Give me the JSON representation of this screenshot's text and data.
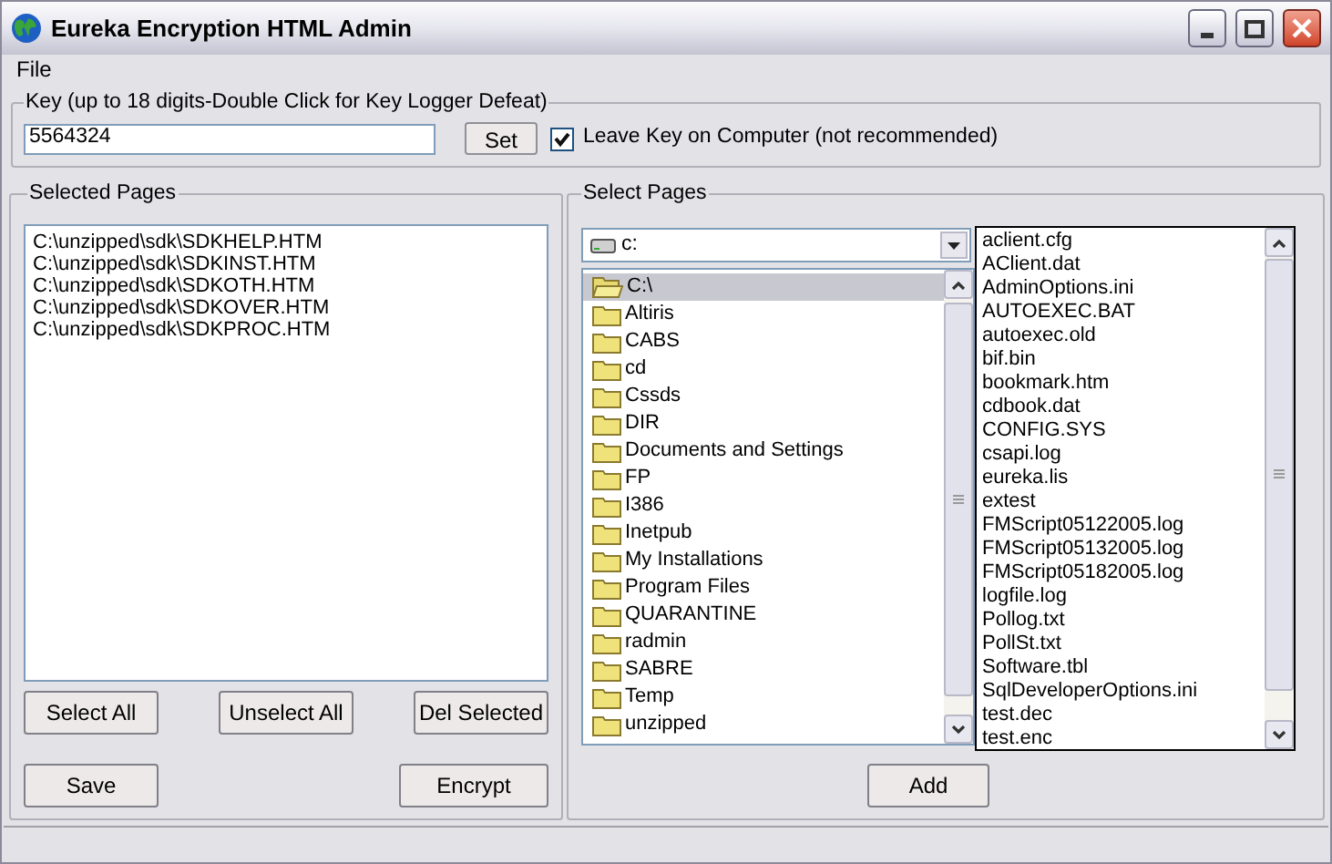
{
  "window": {
    "title": "Eureka Encryption HTML Admin"
  },
  "menu": [
    "File"
  ],
  "key_group": {
    "legend": "Key (up to 18 digits-Double Click for Key Logger Defeat)",
    "value": "5564324",
    "set_button": "Set",
    "leave_key": {
      "label": "Leave Key on Computer (not recommended)",
      "checked": true
    }
  },
  "selected_pages": {
    "legend": "Selected Pages",
    "items": [
      "C:\\unzipped\\sdk\\SDKHELP.HTM",
      "C:\\unzipped\\sdk\\SDKINST.HTM",
      "C:\\unzipped\\sdk\\SDKOTH.HTM",
      "C:\\unzipped\\sdk\\SDKOVER.HTM",
      "C:\\unzipped\\sdk\\SDKPROC.HTM"
    ],
    "buttons": [
      "Select All",
      "Unselect All",
      "Del Selected"
    ],
    "bottom_buttons": [
      "Save",
      "Encrypt"
    ]
  },
  "select_pages": {
    "legend": "Select Pages",
    "drive": "c:",
    "folders": [
      {
        "label": "C:\\",
        "selected": true
      },
      {
        "label": "Altiris",
        "selected": false
      },
      {
        "label": "CABS",
        "selected": false
      },
      {
        "label": "cd",
        "selected": false
      },
      {
        "label": "Cssds",
        "selected": false
      },
      {
        "label": "DIR",
        "selected": false
      },
      {
        "label": "Documents and Settings",
        "selected": false
      },
      {
        "label": "FP",
        "selected": false
      },
      {
        "label": "I386",
        "selected": false
      },
      {
        "label": "Inetpub",
        "selected": false
      },
      {
        "label": "My Installations",
        "selected": false
      },
      {
        "label": "Program Files",
        "selected": false
      },
      {
        "label": "QUARANTINE",
        "selected": false
      },
      {
        "label": "radmin",
        "selected": false
      },
      {
        "label": "SABRE",
        "selected": false
      },
      {
        "label": "Temp",
        "selected": false
      },
      {
        "label": "unzipped",
        "selected": false
      }
    ],
    "files": [
      "aclient.cfg",
      "AClient.dat",
      "AdminOptions.ini",
      "AUTOEXEC.BAT",
      "autoexec.old",
      "bif.bin",
      "bookmark.htm",
      "cdbook.dat",
      "CONFIG.SYS",
      "csapi.log",
      "eureka.lis",
      "extest",
      "FMScript05122005.log",
      "FMScript05132005.log",
      "FMScript05182005.log",
      "logfile.log",
      "Pollog.txt",
      "PollSt.txt",
      "Software.tbl",
      "SqlDeveloperOptions.ini",
      "test.dec",
      "test.enc"
    ],
    "add_button": "Add"
  }
}
